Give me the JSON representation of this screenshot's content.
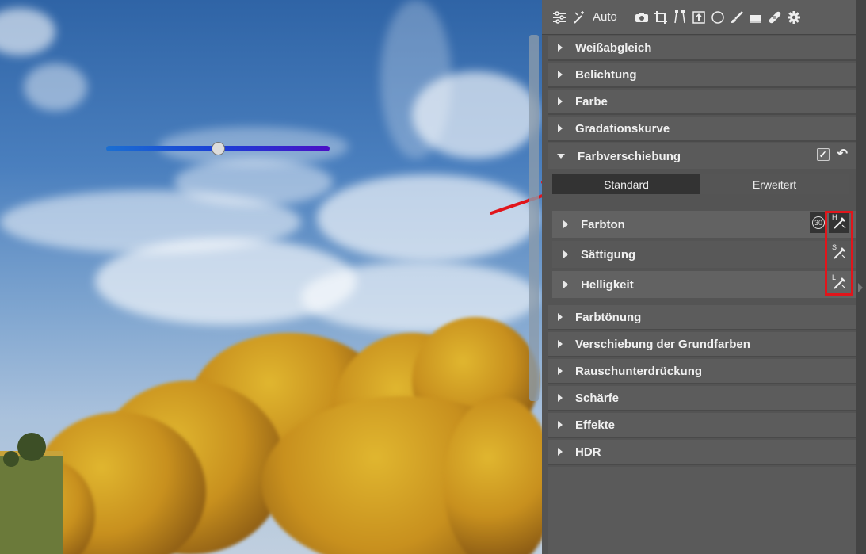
{
  "toolbar": {
    "auto_label": "Auto",
    "icons": [
      "sliders-icon",
      "magic-wand-icon",
      "camera-icon",
      "crop-icon",
      "perspective-icon",
      "export-icon",
      "circle-icon",
      "brush-icon",
      "eraser-icon",
      "healing-icon",
      "gear-icon"
    ]
  },
  "sections_top": [
    {
      "label": "Weißabgleich"
    },
    {
      "label": "Belichtung"
    },
    {
      "label": "Farbe"
    },
    {
      "label": "Gradationskurve"
    }
  ],
  "expanded": {
    "label": "Farbverschiebung",
    "checkbox_symbol": "✓",
    "undo_symbol": "↶",
    "tabs": [
      {
        "label": "Standard",
        "active": true
      },
      {
        "label": "Erweitert",
        "active": false
      }
    ],
    "sub_sections": [
      {
        "label": "Farbton",
        "picker_letter": "H"
      },
      {
        "label": "Sättigung",
        "picker_letter": "S"
      },
      {
        "label": "Helligkeit",
        "picker_letter": "L"
      }
    ],
    "badge": "30"
  },
  "sections_bottom": [
    {
      "label": "Farbtönung"
    },
    {
      "label": "Verschiebung der Grundfarben"
    },
    {
      "label": "Rauschunterdrückung"
    },
    {
      "label": "Schärfe"
    },
    {
      "label": "Effekte"
    },
    {
      "label": "HDR"
    }
  ],
  "overlay_slider": {
    "value": 0.5
  },
  "colors": {
    "highlight": "#e1151b",
    "panel": "#545454"
  }
}
